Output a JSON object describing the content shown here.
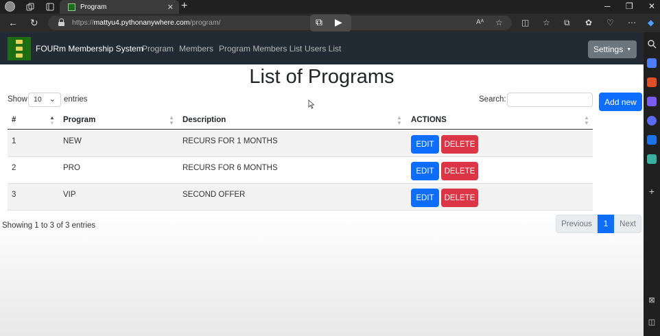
{
  "browser": {
    "tab_title": "Program",
    "url_prefix": "https://",
    "url_host": "mattyu4.pythonanywhere.com",
    "url_path": "/program/",
    "new_tab_icon": "plus-icon",
    "window_controls": [
      "minimize-icon",
      "restore-icon",
      "close-icon"
    ]
  },
  "site": {
    "brand": "FOURm Membership System",
    "nav_links": [
      "Program",
      "Members",
      "Program Members List",
      "Users List"
    ],
    "settings_label": "Settings"
  },
  "main": {
    "title": "List of Programs",
    "show_label": "Show",
    "page_length": "10",
    "entries_label": "entries",
    "search_label": "Search:",
    "search_value": "",
    "add_button": "Add new",
    "columns": [
      "#",
      "Program",
      "Description",
      "ACTIONS"
    ],
    "rows": [
      {
        "num": "1",
        "program": "NEW",
        "description": "RECURS FOR 1 MONTHS"
      },
      {
        "num": "2",
        "program": "PRO",
        "description": "RECURS FOR 6 MONTHS"
      },
      {
        "num": "3",
        "program": "VIP",
        "description": "SECOND OFFER"
      }
    ],
    "edit_label": "EDIT",
    "delete_label": "DELETE",
    "info": "Showing 1 to 3 of 3 entries",
    "pagination": {
      "prev": "Previous",
      "current": "1",
      "next": "Next"
    }
  },
  "colors": {
    "primary": "#0d6efd",
    "danger": "#dc3545",
    "navbar": "#222b33",
    "secondary": "#6c757d"
  }
}
